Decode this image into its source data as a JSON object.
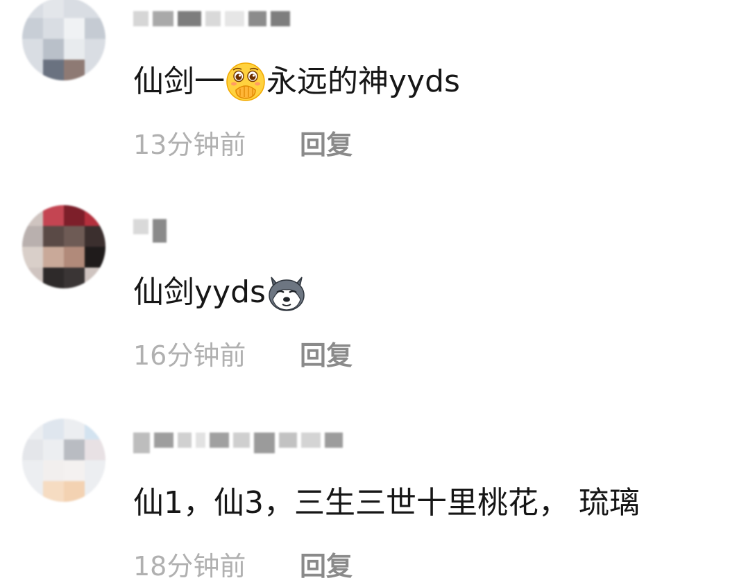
{
  "comments": [
    {
      "text_before": "仙剑一",
      "emoji": "covering-mouth-shy-face-emoji",
      "text_after": "永远的神yyds",
      "time": "13分钟前",
      "reply_label": "回复"
    },
    {
      "text_before": "仙剑yyds",
      "emoji": "husky-dog-emoji",
      "text_after": "",
      "time": "16分钟前",
      "reply_label": "回复"
    },
    {
      "text_before": "仙1，仙3，三生三世十里桃花， 琉璃",
      "emoji": "",
      "text_after": "",
      "time": "18分钟前",
      "reply_label": "回复"
    }
  ],
  "colors": {
    "text": "#161616",
    "timestamp": "#b0b0b0",
    "reply": "#8a8a8a"
  }
}
